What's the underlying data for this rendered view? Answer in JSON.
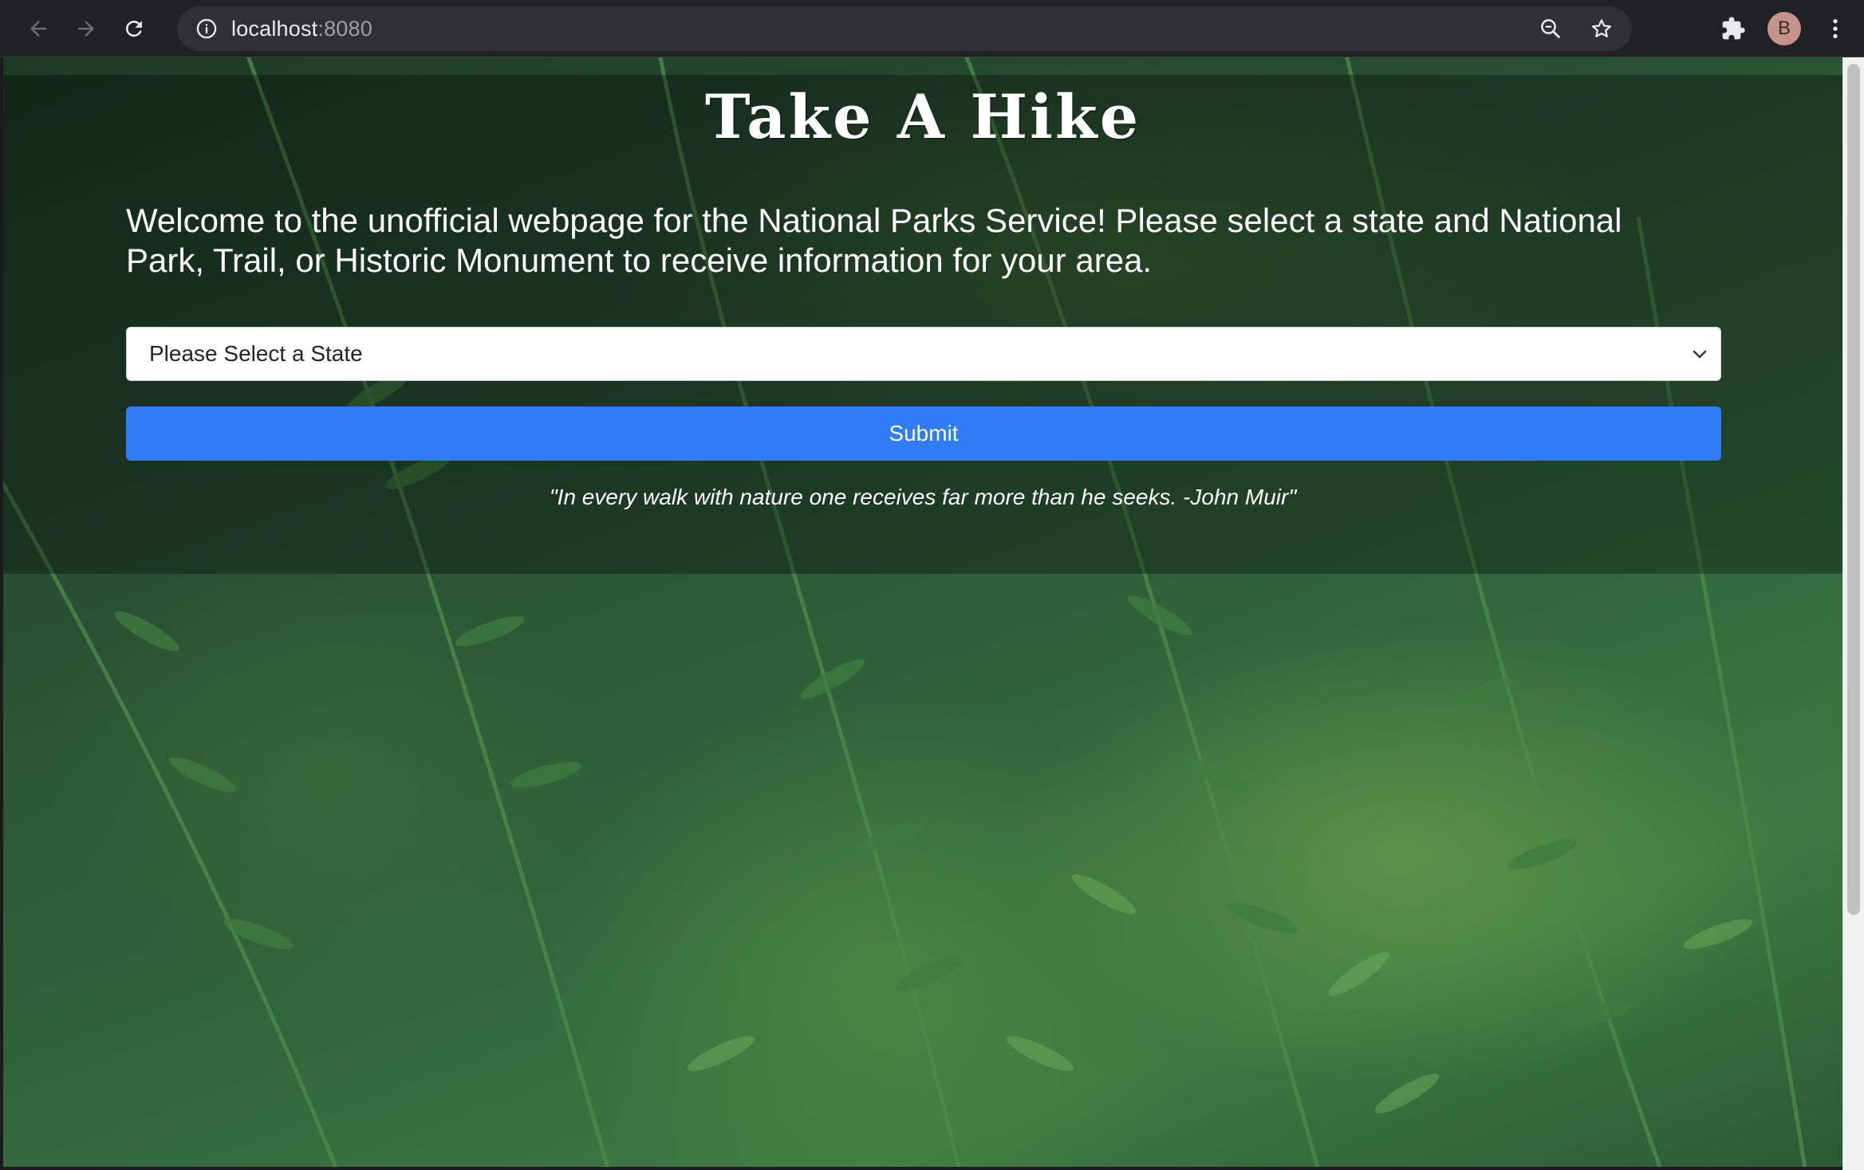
{
  "browser": {
    "url_host": "localhost",
    "url_port": ":8080",
    "profile_initial": "B"
  },
  "icons": {
    "back": "arrow-left-icon",
    "forward": "arrow-right-icon",
    "reload": "reload-icon",
    "site_info": "info-icon",
    "zoom": "magnifier-icon",
    "bookmark": "star-icon",
    "extensions": "puzzle-icon",
    "menu": "kebab-menu-icon",
    "select_arrow": "chevron-down-icon"
  },
  "page": {
    "title": "Take A Hike",
    "welcome": "Welcome to the unofficial webpage for the National Parks Service! Please select a state and National Park, Trail, or Historic Monument to receive information for your area.",
    "state_select": "Please Select a State",
    "submit_label": "Submit",
    "quote": "\"In every walk with nature one receives far more than he seeks. -John Muir\""
  },
  "colors": {
    "chrome_bg": "#202124",
    "omnibox_bg": "#2f3033",
    "submit_bg": "#2f7cf6",
    "avatar_bg": "#c5938a"
  }
}
